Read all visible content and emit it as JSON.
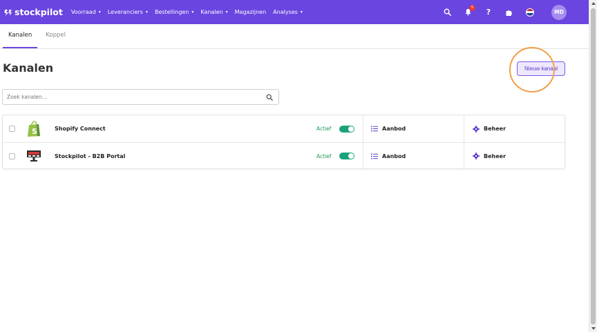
{
  "navbar": {
    "brand": "stockpilot",
    "menu": [
      {
        "label": "Voorraad",
        "caret": "▾"
      },
      {
        "label": "Leveranciers",
        "caret": "▾"
      },
      {
        "label": "Bestellingen",
        "caret": "▾"
      },
      {
        "label": "Kanalen",
        "caret": "▾"
      },
      {
        "label": "Magazijnen",
        "caret": ""
      },
      {
        "label": "Analyses",
        "caret": "▾"
      }
    ],
    "notification_count": "5",
    "help_label": "?",
    "avatar_initials": "MD",
    "icons": [
      "search-icon",
      "bell-icon",
      "help-icon",
      "puzzle-icon",
      "flag-nl-icon"
    ],
    "colors": {
      "bar": "#6a45e0",
      "badge": "#e53935",
      "avatar": "#a58cf0"
    }
  },
  "tabs": [
    {
      "label": "Kanalen",
      "active": true
    },
    {
      "label": "Koppel",
      "active": false
    }
  ],
  "page": {
    "title": "Kanalen",
    "new_button": "Nieuw kanaal"
  },
  "search": {
    "placeholder": "Zoek kanalen..."
  },
  "channels": [
    {
      "name": "Shopify Connect",
      "logo": "shopify-bag-icon",
      "status": "Actief",
      "enabled": true,
      "offer_label": "Aanbod",
      "manage_label": "Beheer"
    },
    {
      "name": "Stockpilot - B2B Portal",
      "logo": "b2b-portal-icon",
      "status": "Actief",
      "enabled": true,
      "offer_label": "Aanbod",
      "manage_label": "Beheer"
    }
  ],
  "colors": {
    "accent": "#6a45e0",
    "active_status": "#1d9a55",
    "toggle_on": "#1aa37a",
    "highlight_ring": "#f2a04a"
  }
}
